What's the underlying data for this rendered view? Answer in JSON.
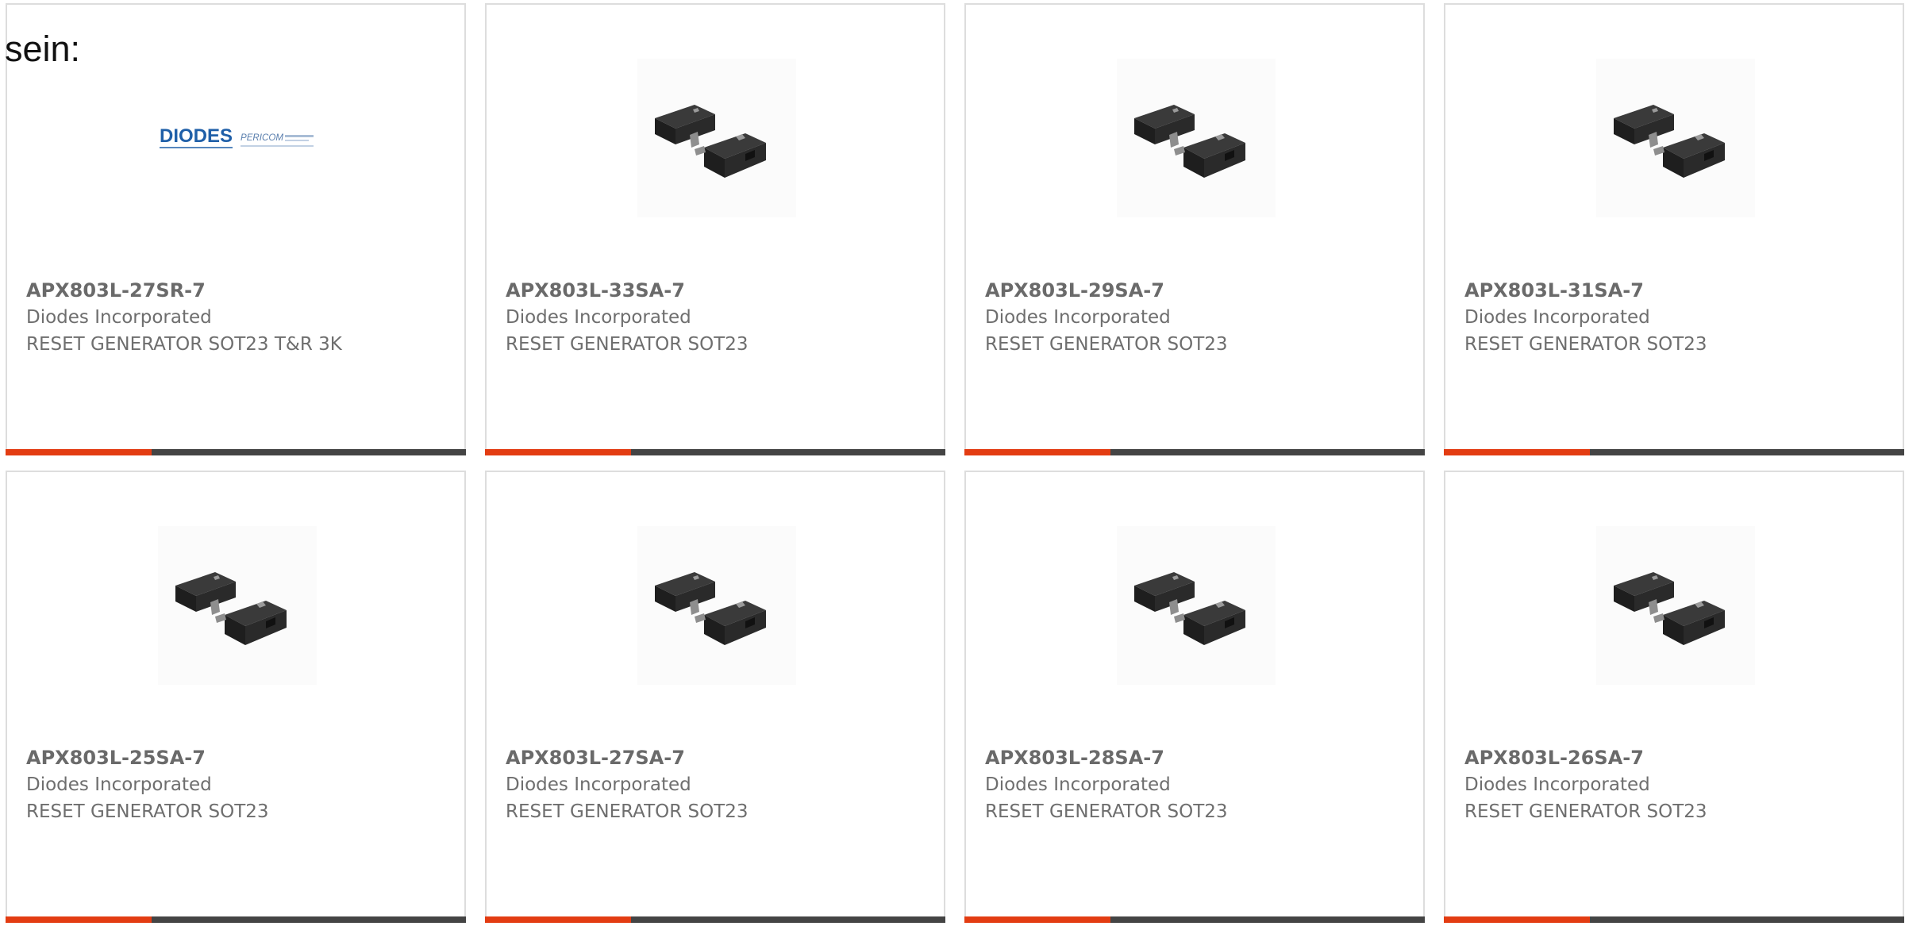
{
  "page": {
    "intro_text": "sein:"
  },
  "colors": {
    "accent": "#e33c12",
    "bar_dark": "#444444",
    "card_border": "#dddddd",
    "text": "#666666"
  },
  "logo_text": "DIODES INCORPORATED PERICOM",
  "products": [
    {
      "part": "APX803L-27SR-7",
      "manufacturer": "Diodes Incorporated",
      "description": "RESET GENERATOR SOT23 T&R 3K",
      "image": "diodes-pericom-logo"
    },
    {
      "part": "APX803L-33SA-7",
      "manufacturer": "Diodes Incorporated",
      "description": "RESET GENERATOR SOT23",
      "image": "sot23-package"
    },
    {
      "part": "APX803L-29SA-7",
      "manufacturer": "Diodes Incorporated",
      "description": "RESET GENERATOR SOT23",
      "image": "sot23-package"
    },
    {
      "part": "APX803L-31SA-7",
      "manufacturer": "Diodes Incorporated",
      "description": "RESET GENERATOR SOT23",
      "image": "sot23-package"
    },
    {
      "part": "APX803L-25SA-7",
      "manufacturer": "Diodes Incorporated",
      "description": "RESET GENERATOR SOT23",
      "image": "sot23-package"
    },
    {
      "part": "APX803L-27SA-7",
      "manufacturer": "Diodes Incorporated",
      "description": "RESET GENERATOR SOT23",
      "image": "sot23-package"
    },
    {
      "part": "APX803L-28SA-7",
      "manufacturer": "Diodes Incorporated",
      "description": "RESET GENERATOR SOT23",
      "image": "sot23-package"
    },
    {
      "part": "APX803L-26SA-7",
      "manufacturer": "Diodes Incorporated",
      "description": "RESET GENERATOR SOT23",
      "image": "sot23-package"
    }
  ]
}
